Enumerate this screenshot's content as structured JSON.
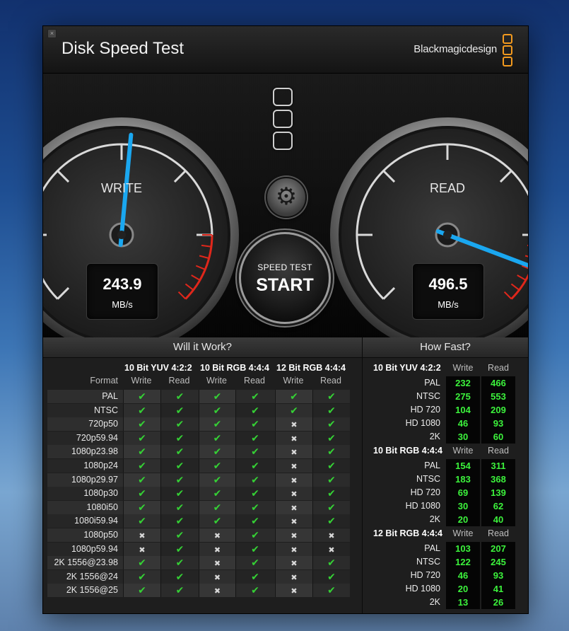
{
  "window": {
    "title": "Disk Speed Test",
    "brand": "Blackmagicdesign",
    "close_glyph": "×"
  },
  "gauges": {
    "write": {
      "label": "WRITE",
      "value": "243.9",
      "unit": "MB/s",
      "needle_fraction": 0.52
    },
    "read": {
      "label": "READ",
      "value": "496.5",
      "unit": "MB/s",
      "needle_fraction": 0.91
    }
  },
  "controls": {
    "settings_icon": "gear-icon",
    "start_small": "SPEED TEST",
    "start_big": "START"
  },
  "will_it_work": {
    "title": "Will it Work?",
    "format_header": "Format",
    "groups": [
      "10 Bit YUV 4:2:2",
      "10 Bit RGB 4:4:4",
      "12 Bit RGB 4:4:4"
    ],
    "subheaders": [
      "Write",
      "Read"
    ],
    "rows": [
      {
        "format": "PAL",
        "cells": [
          "c",
          "c",
          "c",
          "c",
          "c",
          "c"
        ]
      },
      {
        "format": "NTSC",
        "cells": [
          "c",
          "c",
          "c",
          "c",
          "c",
          "c"
        ]
      },
      {
        "format": "720p50",
        "cells": [
          "c",
          "c",
          "c",
          "c",
          "x",
          "c"
        ]
      },
      {
        "format": "720p59.94",
        "cells": [
          "c",
          "c",
          "c",
          "c",
          "x",
          "c"
        ]
      },
      {
        "format": "1080p23.98",
        "cells": [
          "c",
          "c",
          "c",
          "c",
          "x",
          "c"
        ]
      },
      {
        "format": "1080p24",
        "cells": [
          "c",
          "c",
          "c",
          "c",
          "x",
          "c"
        ]
      },
      {
        "format": "1080p29.97",
        "cells": [
          "c",
          "c",
          "c",
          "c",
          "x",
          "c"
        ]
      },
      {
        "format": "1080p30",
        "cells": [
          "c",
          "c",
          "c",
          "c",
          "x",
          "c"
        ]
      },
      {
        "format": "1080i50",
        "cells": [
          "c",
          "c",
          "c",
          "c",
          "x",
          "c"
        ]
      },
      {
        "format": "1080i59.94",
        "cells": [
          "c",
          "c",
          "c",
          "c",
          "x",
          "c"
        ]
      },
      {
        "format": "1080p50",
        "cells": [
          "x",
          "c",
          "x",
          "c",
          "x",
          "x"
        ]
      },
      {
        "format": "1080p59.94",
        "cells": [
          "x",
          "c",
          "x",
          "c",
          "x",
          "x"
        ]
      },
      {
        "format": "2K 1556@23.98",
        "cells": [
          "c",
          "c",
          "x",
          "c",
          "x",
          "c"
        ]
      },
      {
        "format": "2K 1556@24",
        "cells": [
          "c",
          "c",
          "x",
          "c",
          "x",
          "c"
        ]
      },
      {
        "format": "2K 1556@25",
        "cells": [
          "c",
          "c",
          "x",
          "c",
          "x",
          "c"
        ]
      }
    ]
  },
  "how_fast": {
    "title": "How Fast?",
    "subheaders": [
      "Write",
      "Read"
    ],
    "groups": [
      {
        "name": "10 Bit YUV 4:2:2",
        "rows": [
          {
            "format": "PAL",
            "write": "232",
            "read": "466"
          },
          {
            "format": "NTSC",
            "write": "275",
            "read": "553"
          },
          {
            "format": "HD 720",
            "write": "104",
            "read": "209"
          },
          {
            "format": "HD 1080",
            "write": "46",
            "read": "93"
          },
          {
            "format": "2K",
            "write": "30",
            "read": "60"
          }
        ]
      },
      {
        "name": "10 Bit RGB 4:4:4",
        "rows": [
          {
            "format": "PAL",
            "write": "154",
            "read": "311"
          },
          {
            "format": "NTSC",
            "write": "183",
            "read": "368"
          },
          {
            "format": "HD 720",
            "write": "69",
            "read": "139"
          },
          {
            "format": "HD 1080",
            "write": "30",
            "read": "62"
          },
          {
            "format": "2K",
            "write": "20",
            "read": "40"
          }
        ]
      },
      {
        "name": "12 Bit RGB 4:4:4",
        "rows": [
          {
            "format": "PAL",
            "write": "103",
            "read": "207"
          },
          {
            "format": "NTSC",
            "write": "122",
            "read": "245"
          },
          {
            "format": "HD 720",
            "write": "46",
            "read": "93"
          },
          {
            "format": "HD 1080",
            "write": "20",
            "read": "41"
          },
          {
            "format": "2K",
            "write": "13",
            "read": "26"
          }
        ]
      }
    ]
  },
  "colors": {
    "needle": "#1aa7f0",
    "check": "#35d135",
    "value_green": "#3cf23c",
    "redline": "#e0271b",
    "brand_orange": "#f39a1e"
  }
}
